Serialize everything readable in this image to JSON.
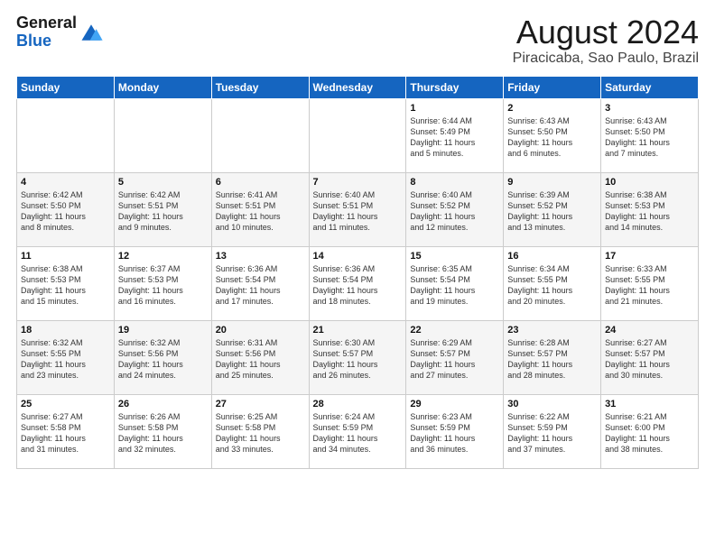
{
  "header": {
    "logo_general": "General",
    "logo_blue": "Blue",
    "month_year": "August 2024",
    "location": "Piracicaba, Sao Paulo, Brazil"
  },
  "days_of_week": [
    "Sunday",
    "Monday",
    "Tuesday",
    "Wednesday",
    "Thursday",
    "Friday",
    "Saturday"
  ],
  "weeks": [
    [
      {
        "day": "",
        "info": ""
      },
      {
        "day": "",
        "info": ""
      },
      {
        "day": "",
        "info": ""
      },
      {
        "day": "",
        "info": ""
      },
      {
        "day": "1",
        "info": "Sunrise: 6:44 AM\nSunset: 5:49 PM\nDaylight: 11 hours\nand 5 minutes."
      },
      {
        "day": "2",
        "info": "Sunrise: 6:43 AM\nSunset: 5:50 PM\nDaylight: 11 hours\nand 6 minutes."
      },
      {
        "day": "3",
        "info": "Sunrise: 6:43 AM\nSunset: 5:50 PM\nDaylight: 11 hours\nand 7 minutes."
      }
    ],
    [
      {
        "day": "4",
        "info": "Sunrise: 6:42 AM\nSunset: 5:50 PM\nDaylight: 11 hours\nand 8 minutes."
      },
      {
        "day": "5",
        "info": "Sunrise: 6:42 AM\nSunset: 5:51 PM\nDaylight: 11 hours\nand 9 minutes."
      },
      {
        "day": "6",
        "info": "Sunrise: 6:41 AM\nSunset: 5:51 PM\nDaylight: 11 hours\nand 10 minutes."
      },
      {
        "day": "7",
        "info": "Sunrise: 6:40 AM\nSunset: 5:51 PM\nDaylight: 11 hours\nand 11 minutes."
      },
      {
        "day": "8",
        "info": "Sunrise: 6:40 AM\nSunset: 5:52 PM\nDaylight: 11 hours\nand 12 minutes."
      },
      {
        "day": "9",
        "info": "Sunrise: 6:39 AM\nSunset: 5:52 PM\nDaylight: 11 hours\nand 13 minutes."
      },
      {
        "day": "10",
        "info": "Sunrise: 6:38 AM\nSunset: 5:53 PM\nDaylight: 11 hours\nand 14 minutes."
      }
    ],
    [
      {
        "day": "11",
        "info": "Sunrise: 6:38 AM\nSunset: 5:53 PM\nDaylight: 11 hours\nand 15 minutes."
      },
      {
        "day": "12",
        "info": "Sunrise: 6:37 AM\nSunset: 5:53 PM\nDaylight: 11 hours\nand 16 minutes."
      },
      {
        "day": "13",
        "info": "Sunrise: 6:36 AM\nSunset: 5:54 PM\nDaylight: 11 hours\nand 17 minutes."
      },
      {
        "day": "14",
        "info": "Sunrise: 6:36 AM\nSunset: 5:54 PM\nDaylight: 11 hours\nand 18 minutes."
      },
      {
        "day": "15",
        "info": "Sunrise: 6:35 AM\nSunset: 5:54 PM\nDaylight: 11 hours\nand 19 minutes."
      },
      {
        "day": "16",
        "info": "Sunrise: 6:34 AM\nSunset: 5:55 PM\nDaylight: 11 hours\nand 20 minutes."
      },
      {
        "day": "17",
        "info": "Sunrise: 6:33 AM\nSunset: 5:55 PM\nDaylight: 11 hours\nand 21 minutes."
      }
    ],
    [
      {
        "day": "18",
        "info": "Sunrise: 6:32 AM\nSunset: 5:55 PM\nDaylight: 11 hours\nand 23 minutes."
      },
      {
        "day": "19",
        "info": "Sunrise: 6:32 AM\nSunset: 5:56 PM\nDaylight: 11 hours\nand 24 minutes."
      },
      {
        "day": "20",
        "info": "Sunrise: 6:31 AM\nSunset: 5:56 PM\nDaylight: 11 hours\nand 25 minutes."
      },
      {
        "day": "21",
        "info": "Sunrise: 6:30 AM\nSunset: 5:57 PM\nDaylight: 11 hours\nand 26 minutes."
      },
      {
        "day": "22",
        "info": "Sunrise: 6:29 AM\nSunset: 5:57 PM\nDaylight: 11 hours\nand 27 minutes."
      },
      {
        "day": "23",
        "info": "Sunrise: 6:28 AM\nSunset: 5:57 PM\nDaylight: 11 hours\nand 28 minutes."
      },
      {
        "day": "24",
        "info": "Sunrise: 6:27 AM\nSunset: 5:57 PM\nDaylight: 11 hours\nand 30 minutes."
      }
    ],
    [
      {
        "day": "25",
        "info": "Sunrise: 6:27 AM\nSunset: 5:58 PM\nDaylight: 11 hours\nand 31 minutes."
      },
      {
        "day": "26",
        "info": "Sunrise: 6:26 AM\nSunset: 5:58 PM\nDaylight: 11 hours\nand 32 minutes."
      },
      {
        "day": "27",
        "info": "Sunrise: 6:25 AM\nSunset: 5:58 PM\nDaylight: 11 hours\nand 33 minutes."
      },
      {
        "day": "28",
        "info": "Sunrise: 6:24 AM\nSunset: 5:59 PM\nDaylight: 11 hours\nand 34 minutes."
      },
      {
        "day": "29",
        "info": "Sunrise: 6:23 AM\nSunset: 5:59 PM\nDaylight: 11 hours\nand 36 minutes."
      },
      {
        "day": "30",
        "info": "Sunrise: 6:22 AM\nSunset: 5:59 PM\nDaylight: 11 hours\nand 37 minutes."
      },
      {
        "day": "31",
        "info": "Sunrise: 6:21 AM\nSunset: 6:00 PM\nDaylight: 11 hours\nand 38 minutes."
      }
    ]
  ]
}
